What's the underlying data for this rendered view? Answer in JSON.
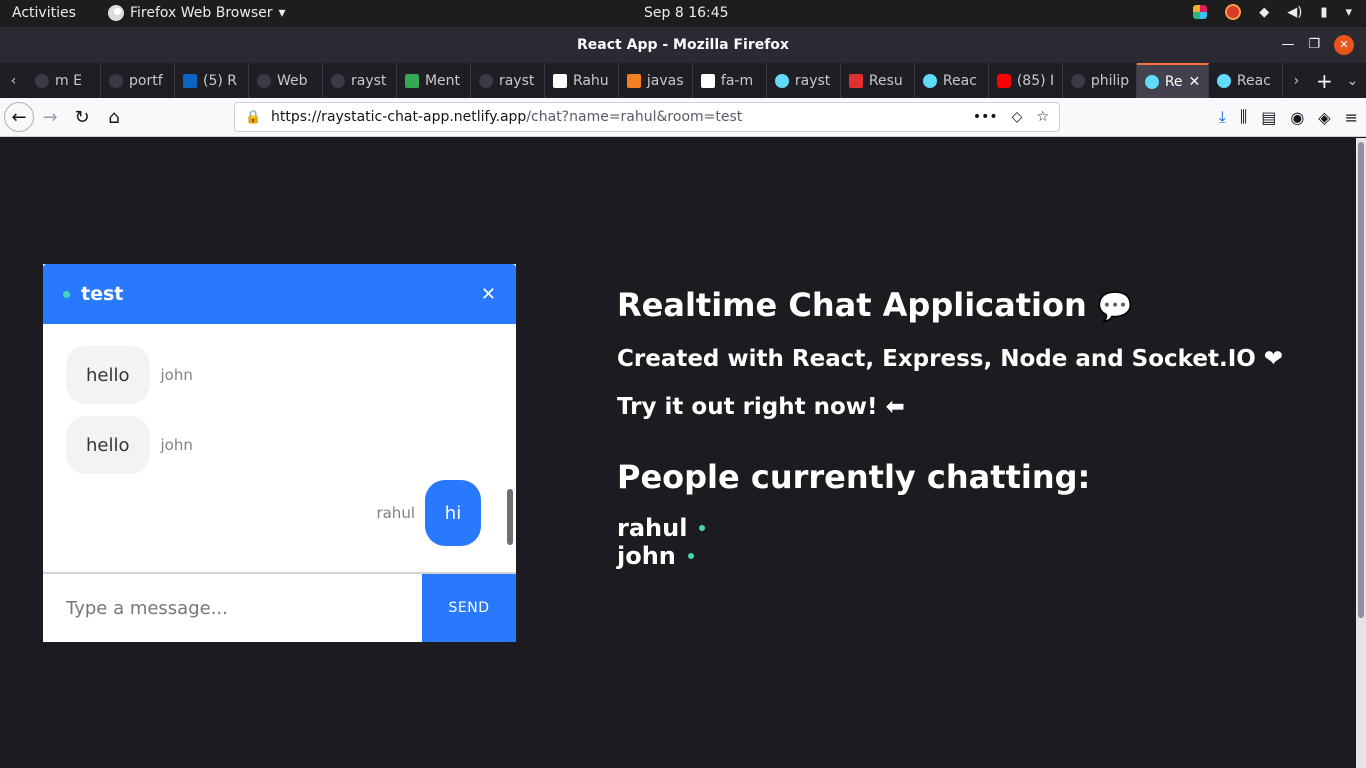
{
  "system": {
    "activities": "Activities",
    "app_menu": "Firefox Web Browser",
    "clock": "Sep 8  16:45"
  },
  "window": {
    "title": "React App - Mozilla Firefox"
  },
  "tabs": [
    {
      "label": "m E"
    },
    {
      "label": "portf"
    },
    {
      "label": "(5) R"
    },
    {
      "label": "Web"
    },
    {
      "label": "rayst"
    },
    {
      "label": "Ment"
    },
    {
      "label": "rayst"
    },
    {
      "label": "Rahu"
    },
    {
      "label": "javas"
    },
    {
      "label": "fa-m"
    },
    {
      "label": "rayst"
    },
    {
      "label": "Resu"
    },
    {
      "label": "Reac"
    },
    {
      "label": "(85) I"
    },
    {
      "label": "philip"
    },
    {
      "label": "Re"
    },
    {
      "label": "Reac"
    }
  ],
  "address": {
    "host": "https://raystatic-chat-app.netlify.app",
    "path": "/chat?name=rahul&room=test"
  },
  "chat": {
    "room": "test",
    "messages": [
      {
        "text": "hello",
        "sender": "john"
      },
      {
        "text": "hello",
        "sender": "john"
      },
      {
        "text": "hi",
        "sender": "rahul"
      }
    ],
    "input_placeholder": "Type a message...",
    "send_label": "SEND"
  },
  "info": {
    "title": "Realtime Chat Application",
    "title_emoji": "💬",
    "subtitle": "Created with React, Express, Node and Socket.IO ❤",
    "try": "Try it out right now! ⬅",
    "people_title": "People currently chatting:",
    "people": [
      "rahul",
      "john"
    ]
  },
  "colors": {
    "accent": "#2979ff",
    "online": "#3fd8b6",
    "page_bg": "#1c1b1f"
  }
}
